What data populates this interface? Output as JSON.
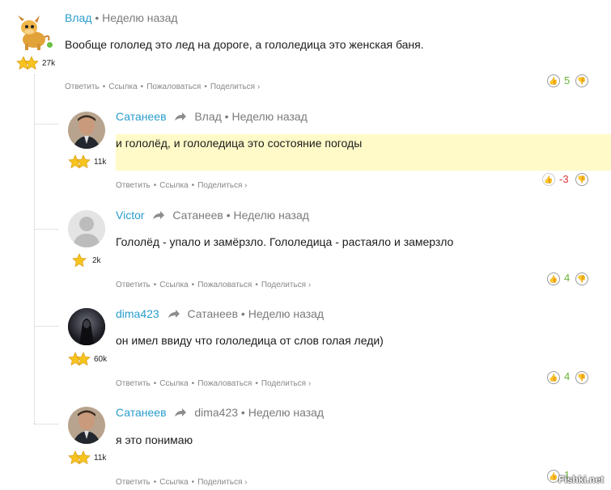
{
  "actions": {
    "reply": "Ответить",
    "link": "Ссылка",
    "report": "Пожаловаться",
    "share": "Поделиться ›"
  },
  "comments": [
    {
      "author": "Влад",
      "time": "Неделю назад",
      "text": "Вообще гололед это лед на дороге, а гололедица это женская баня.",
      "karma": "27k",
      "score": "5"
    },
    {
      "author": "Сатанеев",
      "reply_to": "Влад",
      "time": "Неделю назад",
      "text": "и гололёд, и гололедица это состояние погоды",
      "karma": "11k",
      "score": "-3"
    },
    {
      "author": "Victor",
      "reply_to": "Сатанеев",
      "time": "Неделю назад",
      "text": "Гололёд - упало и замёрзло. Гололедица - растаяло и замерзло",
      "karma": "2k",
      "score": "4"
    },
    {
      "author": "dima423",
      "reply_to": "Сатанеев",
      "time": "Неделю назад",
      "text": "он имел ввиду что гололедица от слов голая леди)",
      "karma": "60k",
      "score": "4"
    },
    {
      "author": "Сатанеев",
      "reply_to": "dima423",
      "time": "Неделю назад",
      "text": "я это понимаю",
      "karma": "11k",
      "score": "1"
    }
  ],
  "watermark": "Fishki.net",
  "colors": {
    "link": "#2a9dcc",
    "positive": "#6ab437",
    "negative": "#d9373b",
    "highlight": "#fffac8"
  }
}
